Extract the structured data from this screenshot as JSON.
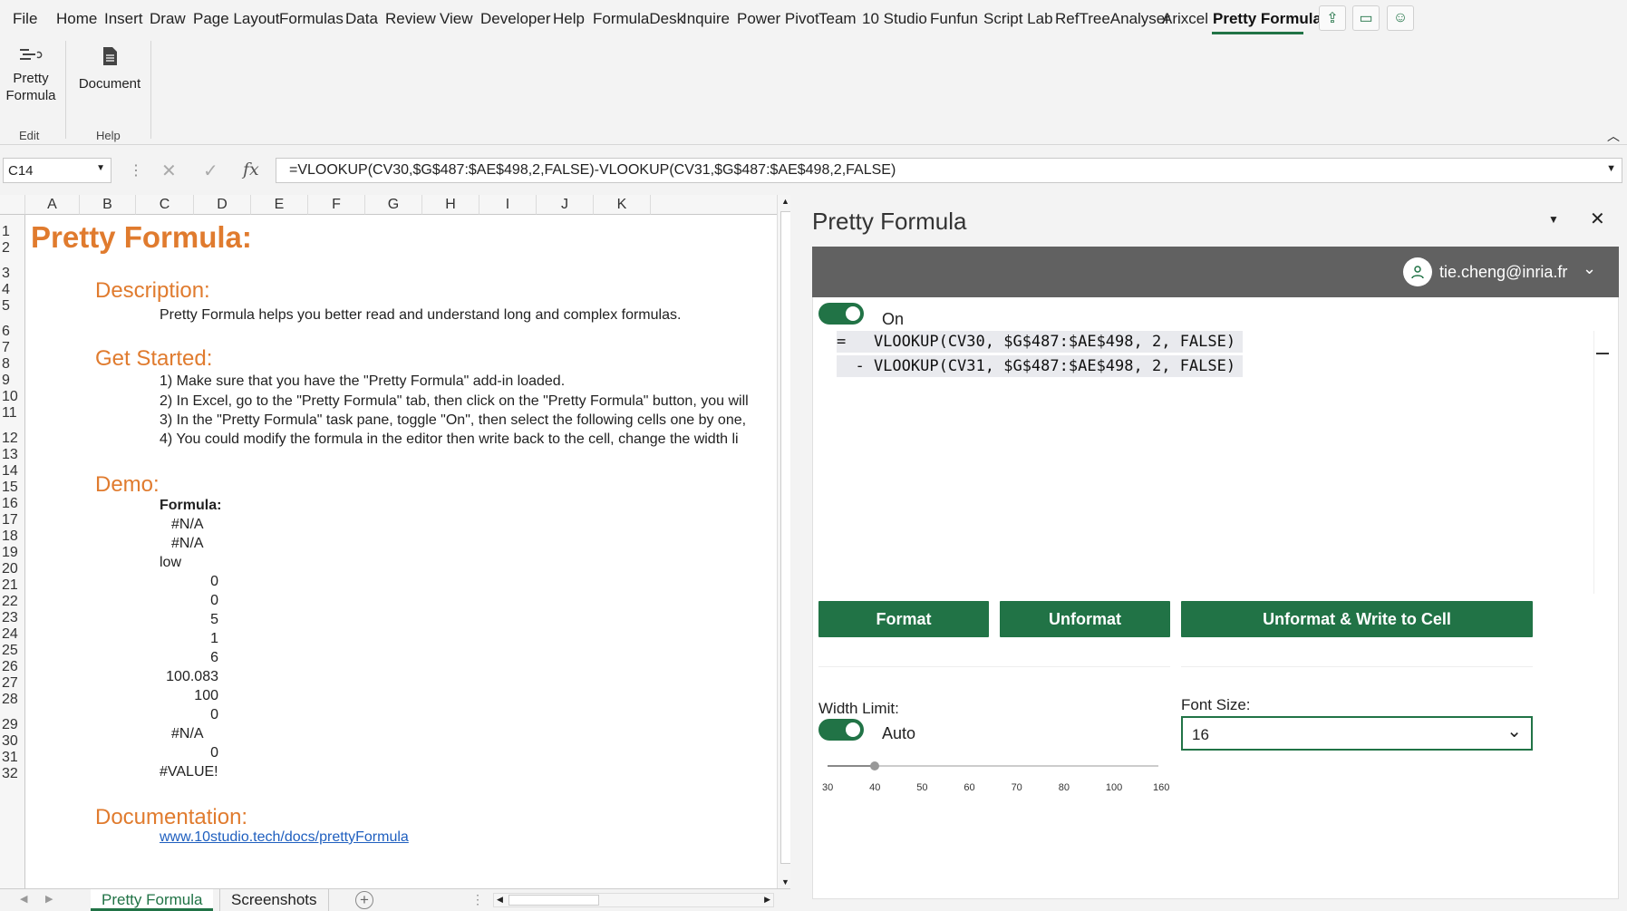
{
  "ribbon_tabs": [
    "File",
    "Home",
    "Insert",
    "Draw",
    "Page Layout",
    "Formulas",
    "Data",
    "Review",
    "View",
    "Developer",
    "Help",
    "FormulaDesk",
    "Inquire",
    "Power Pivot",
    "Team",
    "10 Studio",
    "Funfun",
    "Script Lab",
    "RefTreeAnalyser",
    "Arixcel",
    "Pretty Formula"
  ],
  "active_tab": "Pretty Formula",
  "ribbon": {
    "pretty_formula_btn": [
      "Pretty",
      "Formula"
    ],
    "document_btn": "Document",
    "group_edit": "Edit",
    "group_help": "Help"
  },
  "formula_bar": {
    "name_box": "C14",
    "fx": "fx",
    "formula": "=VLOOKUP(CV30,$G$487:$AE$498,2,FALSE)-VLOOKUP(CV31,$G$487:$AE$498,2,FALSE)"
  },
  "columns": [
    "A",
    "B",
    "C",
    "D",
    "E",
    "F",
    "G",
    "H",
    "I",
    "J",
    "K"
  ],
  "rows": [
    "1",
    "2",
    "3",
    "4",
    "5",
    "6",
    "7",
    "8",
    "9",
    "10",
    "11",
    "12",
    "13",
    "14",
    "15",
    "16",
    "17",
    "18",
    "19",
    "20",
    "21",
    "22",
    "23",
    "24",
    "25",
    "26",
    "27",
    "28",
    "29",
    "30",
    "31",
    "32"
  ],
  "sheet": {
    "title": "Pretty Formula:",
    "description_heading": "Description:",
    "description_text": "Pretty Formula helps you better read and understand long and complex formulas.",
    "get_started_heading": "Get Started:",
    "steps": [
      "1) Make sure that you have the \"Pretty Formula\" add-in loaded.",
      "2) In Excel, go to the \"Pretty Formula\" tab, then click on the \"Pretty Formula\" button, you will",
      "3) In the \"Pretty Formula\" task pane, toggle \"On\", then select the following cells one by one,",
      "4) You could modify the formula in the editor then write back to the cell, change the width li"
    ],
    "demo_heading": "Demo:",
    "formula_label": "Formula:",
    "demo_values": [
      "#N/A",
      "#N/A",
      "low",
      "0",
      "0",
      "5",
      "1",
      "6",
      "100.083",
      "100",
      "0",
      "#N/A",
      "0",
      "#VALUE!"
    ],
    "documentation_heading": "Documentation:",
    "doc_link": "www.10studio.tech/docs/prettyFormula"
  },
  "sheet_tabs": [
    "Pretty Formula",
    "Screenshots"
  ],
  "pane": {
    "title": "Pretty Formula",
    "user": "tie.cheng@inria.fr",
    "toggle_label": "On",
    "code_lines": [
      "=   VLOOKUP(CV30, $G$487:$AE$498, 2, FALSE)",
      "  - VLOOKUP(CV31, $G$487:$AE$498, 2, FALSE)"
    ],
    "format_btn": "Format",
    "unformat_btn": "Unformat",
    "write_btn": "Unformat & Write to Cell",
    "width_limit_label": "Width Limit:",
    "auto_label": "Auto",
    "font_size_label": "Font Size:",
    "font_size_value": "16",
    "slider_ticks": [
      "30",
      "40",
      "50",
      "60",
      "70",
      "80",
      "100",
      "160"
    ],
    "slider_value": 40
  },
  "colors": {
    "accent": "#217346",
    "heading": "#e07b2e",
    "link": "#1f5fbf"
  }
}
